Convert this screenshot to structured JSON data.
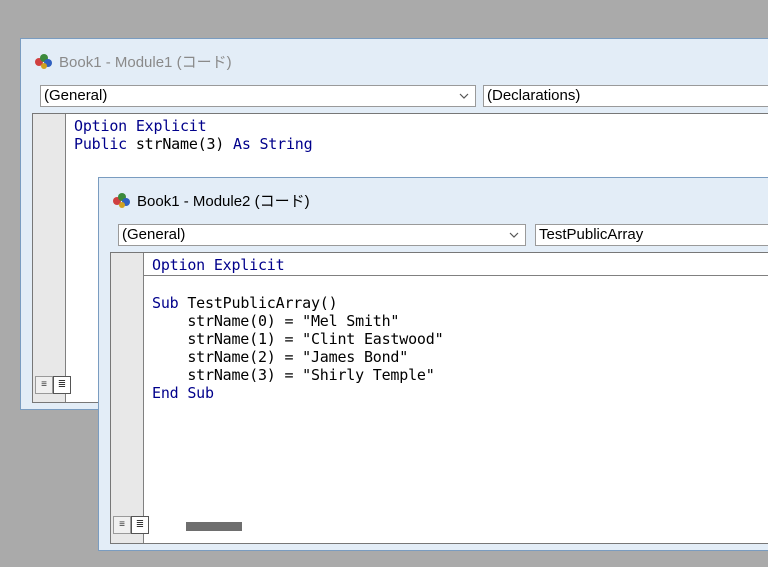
{
  "module1": {
    "title": "Book1 - Module1 (コード)",
    "object_dropdown": "(General)",
    "proc_dropdown": "(Declarations)",
    "lines": [
      [
        {
          "t": "Option Explicit",
          "kw": true
        }
      ],
      [
        {
          "t": "Public",
          "kw": true
        },
        {
          "t": " strName(3) ",
          "kw": false
        },
        {
          "t": "As String",
          "kw": true
        }
      ]
    ]
  },
  "module2": {
    "title": "Book1 - Module2 (コード)",
    "object_dropdown": "(General)",
    "proc_dropdown": "TestPublicArray",
    "declarations": [
      [
        {
          "t": "Option Explicit",
          "kw": true
        }
      ]
    ],
    "lines": [
      [
        {
          "t": "Sub",
          "kw": true
        },
        {
          "t": " TestPublicArray()",
          "kw": false
        }
      ],
      [
        {
          "t": "    strName(0) = \"Mel Smith\"",
          "kw": false
        }
      ],
      [
        {
          "t": "    strName(1) = \"Clint Eastwood\"",
          "kw": false
        }
      ],
      [
        {
          "t": "    strName(2) = \"James Bond\"",
          "kw": false
        }
      ],
      [
        {
          "t": "    strName(3) = \"Shirly Temple\"",
          "kw": false
        }
      ],
      [
        {
          "t": "End Sub",
          "kw": true
        }
      ]
    ]
  },
  "icons": {
    "window_icon": "vba-module-icon",
    "dropdown_arrow": "chevron-down-icon",
    "procedure_view": "procedure-view-icon",
    "full_module_view": "full-module-view-icon"
  },
  "colors": {
    "keyword": "#00008b",
    "window_bg": "#e3edf7"
  }
}
